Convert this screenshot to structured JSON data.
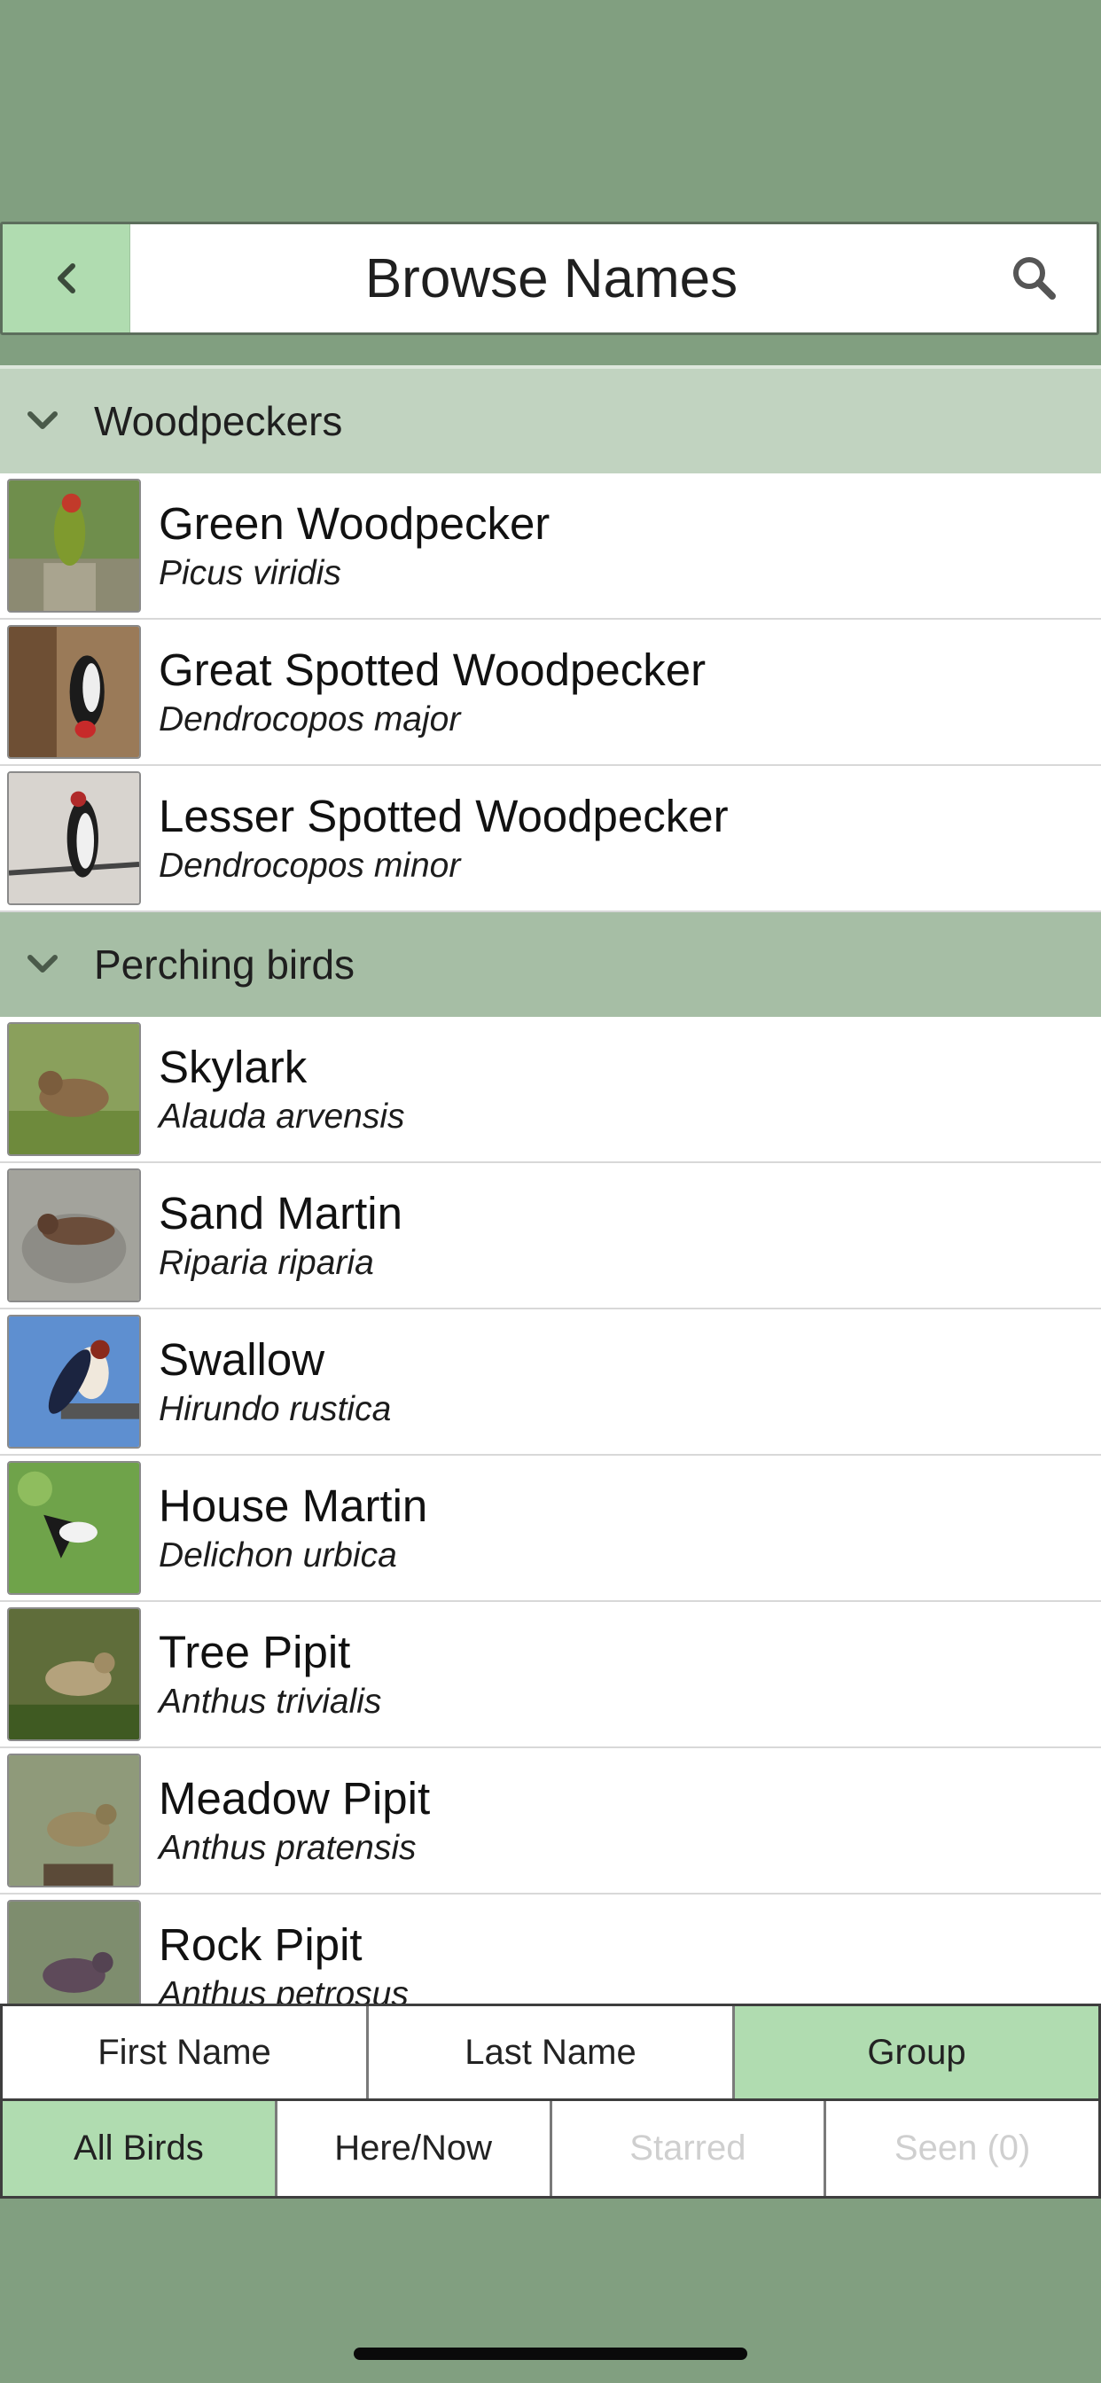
{
  "header": {
    "title": "Browse Names",
    "back_icon": "chevron-left-icon",
    "search_icon": "search-icon"
  },
  "colors": {
    "background": "#819f80",
    "accent": "#b0dcb0",
    "section_woodpeckers": "#c1d3c0",
    "section_perching": "#a6bea5"
  },
  "sections": [
    {
      "label": "Woodpeckers",
      "birds": [
        {
          "common": "Green Woodpecker",
          "latin": "Picus viridis"
        },
        {
          "common": "Great Spotted Woodpecker",
          "latin": "Dendrocopos major"
        },
        {
          "common": "Lesser Spotted Woodpecker",
          "latin": "Dendrocopos minor"
        }
      ]
    },
    {
      "label": "Perching birds",
      "birds": [
        {
          "common": "Skylark",
          "latin": "Alauda arvensis"
        },
        {
          "common": "Sand Martin",
          "latin": "Riparia riparia"
        },
        {
          "common": "Swallow",
          "latin": "Hirundo rustica"
        },
        {
          "common": "House Martin",
          "latin": "Delichon urbica"
        },
        {
          "common": "Tree Pipit",
          "latin": "Anthus trivialis"
        },
        {
          "common": "Meadow Pipit",
          "latin": "Anthus pratensis"
        },
        {
          "common": "Rock Pipit",
          "latin": "Anthus petrosus"
        }
      ]
    }
  ],
  "sort_tabs": [
    {
      "label": "First Name",
      "active": false
    },
    {
      "label": "Last Name",
      "active": false
    },
    {
      "label": "Group",
      "active": true
    }
  ],
  "filter_tabs": [
    {
      "label": "All Birds",
      "active": true,
      "disabled": false
    },
    {
      "label": "Here/Now",
      "active": false,
      "disabled": false
    },
    {
      "label": "Starred",
      "active": false,
      "disabled": true
    },
    {
      "label": "Seen (0)",
      "active": false,
      "disabled": true
    }
  ]
}
